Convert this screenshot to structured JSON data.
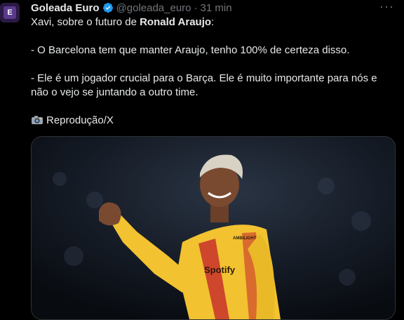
{
  "tweet": {
    "author_name": "Goleada Euro",
    "handle": "@goleada_euro",
    "separator": "·",
    "time": "31 min",
    "more_label": "···",
    "avatar_letter": "E",
    "line1_prefix": "Xavi, sobre o futuro de ",
    "line1_bold": "Ronald Araujo",
    "line1_suffix": ":",
    "line2": "- O Barcelona tem que manter Araujo, tenho 100% de certeza disso.",
    "line3": "- Ele é um jogador crucial para o Barça. Ele é muito importante para nós e não o vejo se juntando a outro time.",
    "credit": "Reprodução/X"
  },
  "media": {
    "sponsor_text": "Spotify",
    "sleeve_text": "AMBILIGHT"
  },
  "colors": {
    "background": "#000000",
    "text": "#e7e9ea",
    "muted": "#71767b",
    "verified": "#1d9bf0",
    "jersey_yellow": "#f2c230",
    "jersey_red": "#c8302b"
  },
  "icons": [
    "verified-badge-icon",
    "more-options-icon",
    "camera-icon"
  ]
}
